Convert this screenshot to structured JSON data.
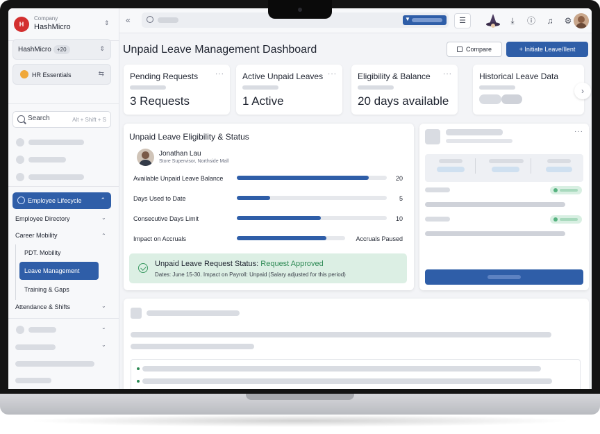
{
  "sidebar": {
    "company": {
      "label": "Company",
      "name": "HashMicro",
      "logo_text": "H"
    },
    "tenant": {
      "name": "HashMicro",
      "count": "+20"
    },
    "module": {
      "name": "HR Essentials"
    },
    "search": {
      "placeholder": "Search",
      "shortcut": "Alt + Shift + S"
    },
    "active_section": "Employee Lifecycle",
    "items": [
      {
        "label": "Employee Directory"
      },
      {
        "label": "Career Mobility"
      },
      {
        "label": "PDT. Mobility"
      },
      {
        "label": "Leave Management"
      },
      {
        "label": "Training & Gaps"
      },
      {
        "label": "Attendance & Shifts"
      }
    ]
  },
  "topbar": {
    "icons": [
      "collapse-icon",
      "search-icon",
      "filter-icon",
      "tune-icon",
      "wizard-avatar",
      "download-icon",
      "help-icon",
      "bell-icon",
      "gear-icon",
      "user-avatar"
    ]
  },
  "main": {
    "title": "Unpaid Leave Management Dashboard",
    "compare_label": "Compare",
    "initiate_label": "+ Initiate Leave/Ilent",
    "stats": [
      {
        "title": "Pending Requests",
        "value": "3 Requests"
      },
      {
        "title": "Active Unpaid Leaves",
        "value": "1 Active"
      },
      {
        "title": "Eligibility & Balance",
        "value": "20 days available"
      },
      {
        "title": "Historical Leave Data",
        "value": ""
      }
    ],
    "eligibility": {
      "title": "Unpaid Leave Eligibility & Status",
      "employee": {
        "name": "Jonathan Lau",
        "role": "Store Supervisor, Northside Mall"
      },
      "metrics": [
        {
          "label": "Available Unpaid Leave Balance",
          "value": "20",
          "fill": 0.88
        },
        {
          "label": "Days Used to Date",
          "value": "5",
          "fill": 0.22
        },
        {
          "label": "Consecutive Days Limit",
          "value": "10",
          "fill": 0.56
        },
        {
          "label": "Impact on Accruals",
          "value": "Accruals Paused",
          "fill": 0.83
        }
      ],
      "status": {
        "prefix": "Unpaid Leave Request Status: ",
        "state": "Request Approved",
        "detail": "Dates: June 15-30. Impact on Payroll: Unpaid (Salary adjusted for this period)"
      }
    }
  },
  "colors": {
    "accent": "#2f5ea8",
    "success": "#2e8a55",
    "success_bg": "#dcefe4",
    "brand": "#d32f2f"
  }
}
